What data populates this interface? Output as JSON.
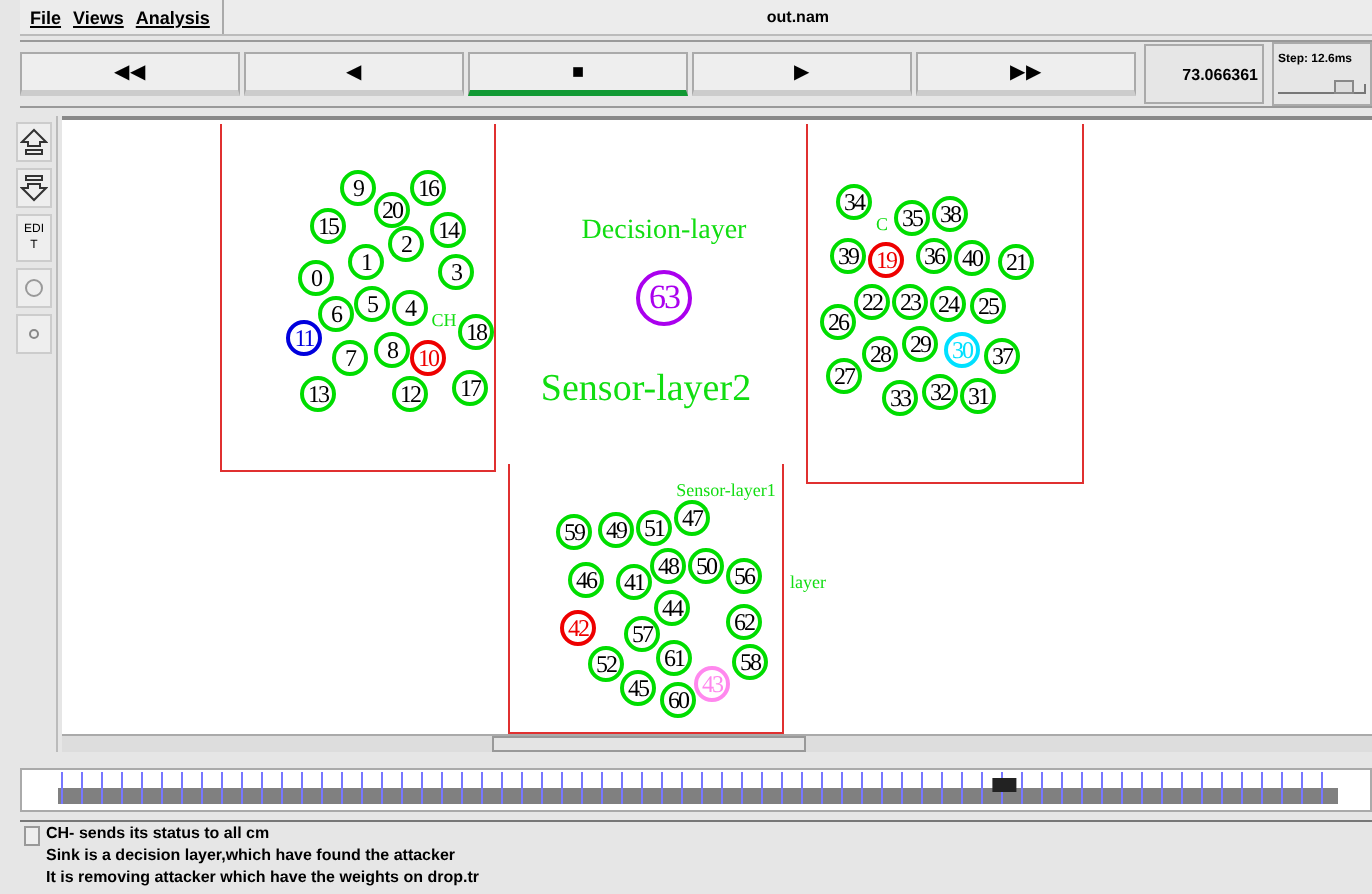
{
  "menu": [
    "File",
    "Views",
    "Analysis"
  ],
  "window": {
    "title": "out.nam"
  },
  "toolbar": {
    "buttons": [
      {
        "symbol": "◀◀",
        "selected": false
      },
      {
        "symbol": "◀",
        "selected": false
      },
      {
        "symbol": "■",
        "selected": true
      },
      {
        "symbol": "▶",
        "selected": false
      },
      {
        "symbol": "▶▶",
        "selected": false
      }
    ],
    "time": "73.066361",
    "step": "Step: 12.6ms"
  },
  "side_tools": [
    {
      "kind": "zoom-in"
    },
    {
      "kind": "zoom-out"
    },
    {
      "kind": "text",
      "label": "EDIT"
    },
    {
      "kind": "circle"
    },
    {
      "kind": "dot"
    }
  ],
  "canvas": {
    "labels": [
      {
        "text": "Decision-layer",
        "kind": "heading"
      },
      {
        "text": "Sensor-layer2",
        "kind": "title"
      },
      {
        "text": "CH",
        "kind": "tag"
      },
      {
        "text": "C",
        "kind": "tag"
      },
      {
        "text": "Sensor-layer1",
        "kind": "tag"
      },
      {
        "text": "layer",
        "kind": "tag"
      }
    ],
    "nodes": [
      {
        "label": "9",
        "kind": "sensor",
        "color": "#00dd00"
      },
      {
        "label": "16",
        "kind": "sensor",
        "color": "#00dd00"
      },
      {
        "label": "15",
        "kind": "sensor",
        "color": "#00dd00"
      },
      {
        "label": "20",
        "kind": "sensor",
        "color": "#00dd00"
      },
      {
        "label": "14",
        "kind": "sensor",
        "color": "#00dd00"
      },
      {
        "label": "2",
        "kind": "sensor",
        "color": "#00dd00"
      },
      {
        "label": "0",
        "kind": "sensor",
        "color": "#00dd00"
      },
      {
        "label": "1",
        "kind": "sensor",
        "color": "#00dd00"
      },
      {
        "label": "3",
        "kind": "sensor",
        "color": "#00dd00"
      },
      {
        "label": "11",
        "kind": "special",
        "color": "#0000dd"
      },
      {
        "label": "6",
        "kind": "sensor",
        "color": "#00dd00"
      },
      {
        "label": "5",
        "kind": "sensor",
        "color": "#00dd00"
      },
      {
        "label": "4",
        "kind": "sensor",
        "color": "#00dd00"
      },
      {
        "label": "18",
        "kind": "sensor",
        "color": "#00dd00"
      },
      {
        "label": "7",
        "kind": "sensor",
        "color": "#00dd00"
      },
      {
        "label": "8",
        "kind": "sensor",
        "color": "#00dd00"
      },
      {
        "label": "10",
        "kind": "special",
        "color": "#ee0000"
      },
      {
        "label": "13",
        "kind": "sensor",
        "color": "#00dd00"
      },
      {
        "label": "12",
        "kind": "sensor",
        "color": "#00dd00"
      },
      {
        "label": "17",
        "kind": "sensor",
        "color": "#00dd00"
      },
      {
        "label": "63",
        "kind": "sink",
        "color": "#aa00ee"
      },
      {
        "label": "34",
        "kind": "sensor",
        "color": "#00dd00"
      },
      {
        "label": "35",
        "kind": "sensor",
        "color": "#00dd00"
      },
      {
        "label": "38",
        "kind": "sensor",
        "color": "#00dd00"
      },
      {
        "label": "39",
        "kind": "sensor",
        "color": "#00dd00"
      },
      {
        "label": "19",
        "kind": "special",
        "color": "#ee0000"
      },
      {
        "label": "36",
        "kind": "sensor",
        "color": "#00dd00"
      },
      {
        "label": "40",
        "kind": "sensor",
        "color": "#00dd00"
      },
      {
        "label": "21",
        "kind": "sensor",
        "color": "#00dd00"
      },
      {
        "label": "26",
        "kind": "sensor",
        "color": "#00dd00"
      },
      {
        "label": "22",
        "kind": "sensor",
        "color": "#00dd00"
      },
      {
        "label": "23",
        "kind": "sensor",
        "color": "#00dd00"
      },
      {
        "label": "24",
        "kind": "sensor",
        "color": "#00dd00"
      },
      {
        "label": "25",
        "kind": "sensor",
        "color": "#00dd00"
      },
      {
        "label": "27",
        "kind": "sensor",
        "color": "#00dd00"
      },
      {
        "label": "28",
        "kind": "sensor",
        "color": "#00dd00"
      },
      {
        "label": "29",
        "kind": "sensor",
        "color": "#00dd00"
      },
      {
        "label": "30",
        "kind": "special",
        "color": "#00e0ff"
      },
      {
        "label": "37",
        "kind": "sensor",
        "color": "#00dd00"
      },
      {
        "label": "33",
        "kind": "sensor",
        "color": "#00dd00"
      },
      {
        "label": "32",
        "kind": "sensor",
        "color": "#00dd00"
      },
      {
        "label": "31",
        "kind": "sensor",
        "color": "#00dd00"
      },
      {
        "label": "59",
        "kind": "sensor",
        "color": "#00dd00"
      },
      {
        "label": "49",
        "kind": "sensor",
        "color": "#00dd00"
      },
      {
        "label": "51",
        "kind": "sensor",
        "color": "#00dd00"
      },
      {
        "label": "47",
        "kind": "sensor",
        "color": "#00dd00"
      },
      {
        "label": "46",
        "kind": "sensor",
        "color": "#00dd00"
      },
      {
        "label": "41",
        "kind": "sensor",
        "color": "#00dd00"
      },
      {
        "label": "48",
        "kind": "sensor",
        "color": "#00dd00"
      },
      {
        "label": "50",
        "kind": "sensor",
        "color": "#00dd00"
      },
      {
        "label": "56",
        "kind": "sensor",
        "color": "#00dd00"
      },
      {
        "label": "42",
        "kind": "special",
        "color": "#ee0000"
      },
      {
        "label": "57",
        "kind": "sensor",
        "color": "#00dd00"
      },
      {
        "label": "44",
        "kind": "sensor",
        "color": "#00dd00"
      },
      {
        "label": "62",
        "kind": "sensor",
        "color": "#00dd00"
      },
      {
        "label": "52",
        "kind": "sensor",
        "color": "#00dd00"
      },
      {
        "label": "61",
        "kind": "sensor",
        "color": "#00dd00"
      },
      {
        "label": "43",
        "kind": "special",
        "color": "#ff88ee"
      },
      {
        "label": "58",
        "kind": "sensor",
        "color": "#00dd00"
      },
      {
        "label": "45",
        "kind": "sensor",
        "color": "#00dd00"
      },
      {
        "label": "60",
        "kind": "sensor",
        "color": "#00dd00"
      }
    ]
  },
  "timeline": {
    "level": 0.73
  },
  "annotations": [
    "CH- sends its status to all cm",
    "Sink is a decision layer,which have found the attacker",
    "It is removing attacker which have the weights on drop.tr"
  ]
}
